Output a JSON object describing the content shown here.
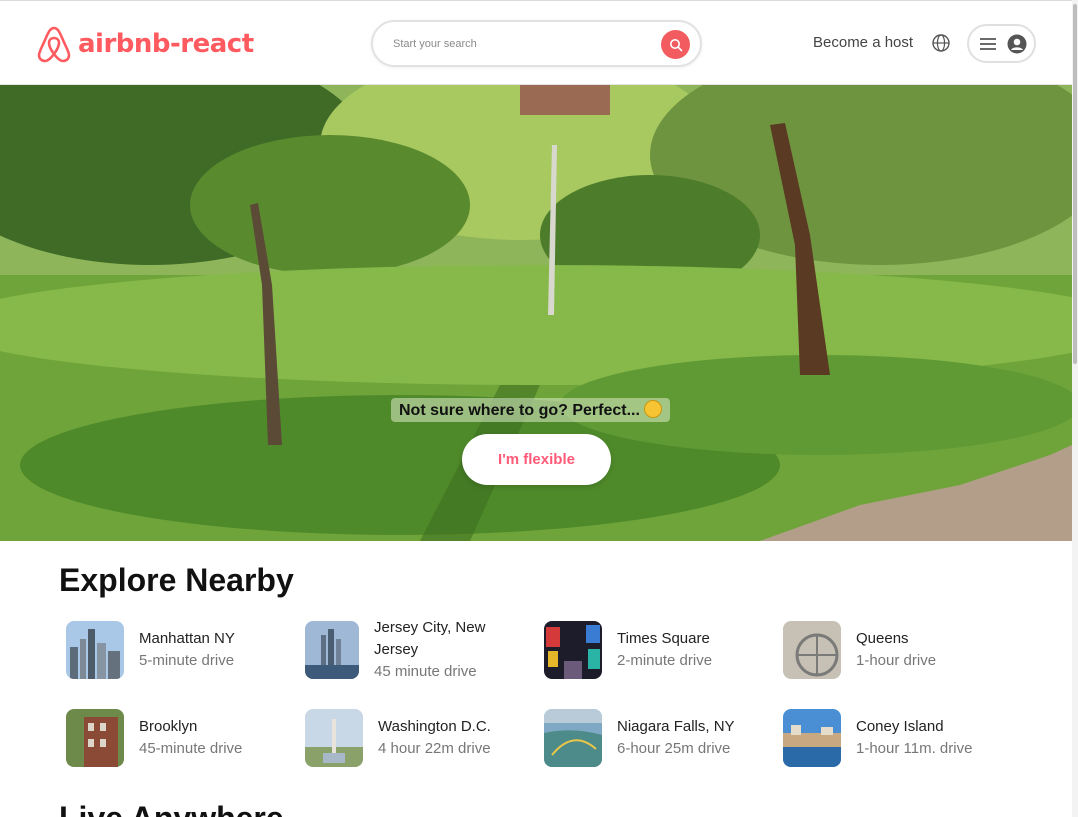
{
  "header": {
    "logo_text": "airbnb-react",
    "search": {
      "placeholder": "Start your search"
    },
    "host_link": "Become a host",
    "icons": [
      "globe-icon",
      "menu-icon",
      "user-icon",
      "search-icon",
      "airbnb-logo-icon"
    ]
  },
  "hero": {
    "caption": "Not sure where to go? Perfect...",
    "button_label": "I'm flexible"
  },
  "explore": {
    "title": "Explore Nearby",
    "items": [
      {
        "name": "Manhattan NY",
        "distance": "5-minute drive"
      },
      {
        "name": "Jersey City, New Jersey",
        "distance": "45 minute drive"
      },
      {
        "name": "Times Square",
        "distance": "2-minute drive"
      },
      {
        "name": "Queens",
        "distance": "1-hour drive"
      },
      {
        "name": "Brooklyn",
        "distance": "45-minute drive"
      },
      {
        "name": "Washington D.C.",
        "distance": "4 hour 22m drive"
      },
      {
        "name": "Niagara Falls, NY",
        "distance": "6-hour 25m drive"
      },
      {
        "name": "Coney Island",
        "distance": "1-hour 11m. drive"
      }
    ]
  },
  "live": {
    "title": "Live Anywhere"
  },
  "colors": {
    "brand": "#ff5a5f",
    "accent_button_text": "#ff5a78"
  }
}
